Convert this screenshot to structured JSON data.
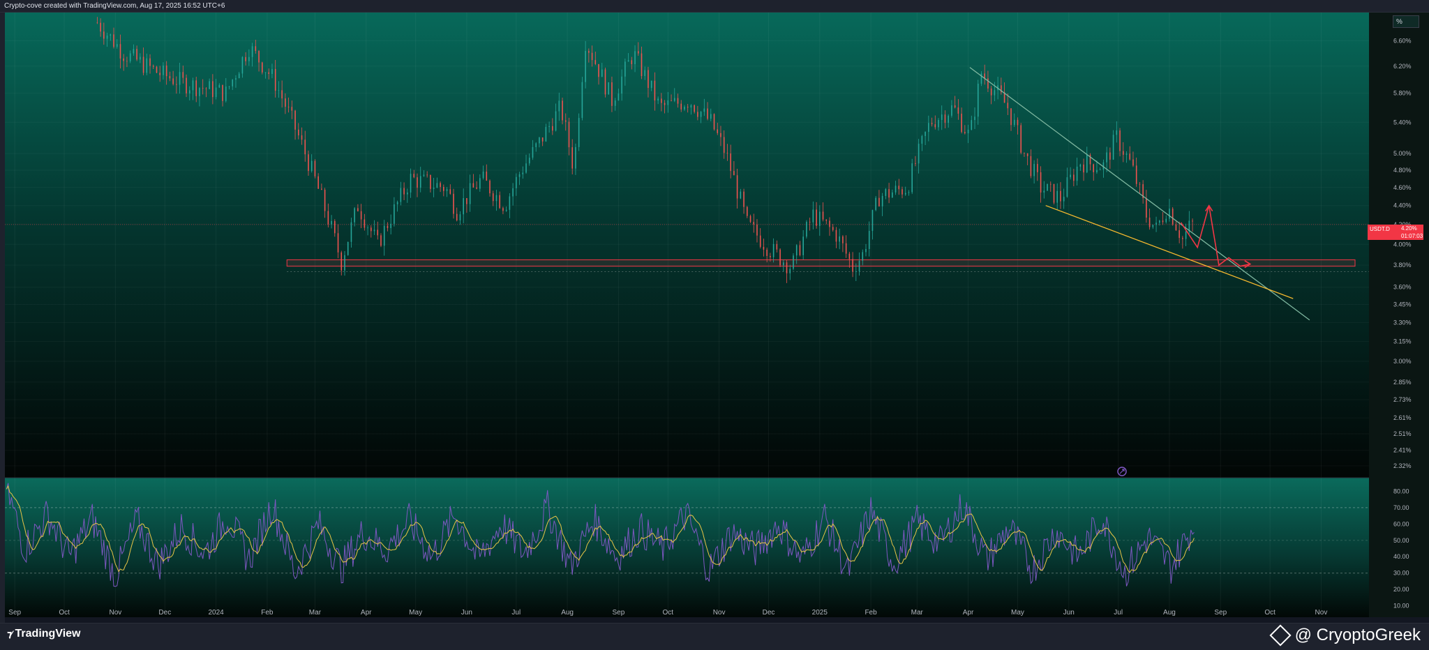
{
  "header": {
    "caption": "Crypto-cove created with TradingView.com, Aug 17, 2025 16:52 UTC+6"
  },
  "scale_button": {
    "label": "%"
  },
  "price_badge": {
    "symbol": "USDT.D",
    "price": "4.20%",
    "countdown": "01:07:03"
  },
  "footer": {
    "brand": "TradingView",
    "watermark": "@ CryoptoGreek"
  },
  "colors": {
    "up_candle": "#26a69a",
    "down_candle": "#ef5350",
    "resistance_line": "#7fb7a0",
    "support_line": "#f5b82e",
    "zone_border": "#f23645",
    "rsi_line": "#7e57c2",
    "rsi_ma": "#e8c547"
  },
  "chart_data": [
    {
      "type": "line",
      "subtype": "candlestick",
      "ylabel": "",
      "y_scale": "log",
      "ylim": [
        2.28,
        7.0
      ],
      "y_ticks": [
        "6.60%",
        "6.20%",
        "5.80%",
        "5.40%",
        "5.00%",
        "4.80%",
        "4.60%",
        "4.40%",
        "4.20%",
        "4.00%",
        "3.80%",
        "3.60%",
        "3.45%",
        "3.30%",
        "3.15%",
        "3.00%",
        "2.85%",
        "2.73%",
        "2.61%",
        "2.51%",
        "2.41%",
        "2.32%"
      ],
      "x_ticks": [
        "Sep",
        "Oct",
        "Nov",
        "Dec",
        "2024",
        "Feb",
        "Mar",
        "Apr",
        "May",
        "Jun",
        "Jul",
        "Aug",
        "Sep",
        "Oct",
        "Nov",
        "Dec",
        "2025",
        "Feb",
        "Mar",
        "Apr",
        "May",
        "Jun",
        "Jul",
        "Aug",
        "Sep",
        "Oct",
        "Nov"
      ],
      "xlim": [
        "2023-08-26",
        "2025-11-30"
      ],
      "series": [
        {
          "x": [
            "2023-10-21",
            "2023-11-06",
            "2023-11-27",
            "2023-12-12",
            "2024-01-07",
            "2024-01-21",
            "2024-02-05",
            "2024-02-26",
            "2024-03-17",
            "2024-03-27",
            "2024-04-08",
            "2024-04-28",
            "2024-05-19",
            "2024-05-26",
            "2024-06-10",
            "2024-06-24",
            "2024-07-04",
            "2024-07-14",
            "2024-07-28",
            "2024-08-05",
            "2024-08-12",
            "2024-08-28",
            "2024-09-10",
            "2024-09-26",
            "2024-10-14",
            "2024-10-27",
            "2024-11-05",
            "2024-11-18",
            "2024-12-02",
            "2024-12-15",
            "2024-12-28",
            "2025-01-11",
            "2025-01-21",
            "2025-01-27",
            "2025-02-06",
            "2025-02-23",
            "2025-03-09",
            "2025-03-23",
            "2025-04-02",
            "2025-04-09",
            "2025-04-25",
            "2025-05-05",
            "2025-05-15",
            "2025-05-27",
            "2025-06-08",
            "2025-06-22",
            "2025-06-30",
            "2025-07-09",
            "2025-07-18",
            "2025-07-24",
            "2025-07-31",
            "2025-08-09",
            "2025-08-14"
          ],
          "y": [
            6.9,
            6.4,
            6.1,
            5.95,
            5.8,
            6.5,
            6.0,
            4.9,
            3.83,
            4.4,
            4.0,
            4.7,
            4.6,
            4.35,
            4.7,
            4.4,
            4.8,
            5.1,
            5.6,
            4.8,
            6.6,
            5.7,
            6.4,
            5.6,
            5.7,
            5.4,
            5.0,
            4.2,
            3.95,
            3.78,
            4.3,
            4.1,
            3.78,
            3.9,
            4.5,
            4.6,
            5.4,
            5.6,
            5.2,
            6.1,
            5.6,
            5.0,
            4.6,
            4.48,
            4.9,
            4.85,
            5.2,
            4.85,
            4.3,
            4.15,
            4.4,
            4.05,
            4.2
          ]
        }
      ],
      "annotations": {
        "support_zone": [
          3.79,
          3.85
        ],
        "resistance_trendline": {
          "x": [
            "2025-04-02",
            "2025-10-25"
          ],
          "y": [
            6.18,
            3.32
          ]
        },
        "support_trendline": {
          "x": [
            "2025-05-18",
            "2025-10-15"
          ],
          "y": [
            4.4,
            3.5
          ]
        },
        "projection": {
          "x": [
            "2025-08-08",
            "2025-08-18",
            "2025-08-25",
            "2025-08-31",
            "2025-09-06",
            "2025-09-13",
            "2025-09-19"
          ],
          "y": [
            4.22,
            3.97,
            4.4,
            3.8,
            3.87,
            3.79,
            3.81
          ]
        }
      },
      "grid": true
    },
    {
      "type": "line",
      "subtype": "oscillator",
      "ylim": [
        6,
        87
      ],
      "y_ticks": [
        "80.00",
        "70.00",
        "60.00",
        "50.00",
        "40.00",
        "30.00",
        "20.00",
        "10.00"
      ],
      "reference_lines": [
        70,
        50,
        30
      ],
      "series": [
        {
          "x": [
            "2023-08-27",
            "2023-09-07",
            "2023-09-21",
            "2023-10-04",
            "2023-10-18",
            "2023-11-01",
            "2023-11-14",
            "2023-11-27",
            "2023-12-11",
            "2023-12-25",
            "2024-01-08",
            "2024-01-21",
            "2024-02-04",
            "2024-02-18",
            "2024-03-03",
            "2024-03-17",
            "2024-03-30",
            "2024-04-13",
            "2024-04-27",
            "2024-05-11",
            "2024-05-25",
            "2024-06-08",
            "2024-06-22",
            "2024-07-06",
            "2024-07-20",
            "2024-08-03",
            "2024-08-17",
            "2024-08-31",
            "2024-09-14",
            "2024-09-28",
            "2024-10-12",
            "2024-10-26",
            "2024-11-09",
            "2024-11-23",
            "2024-12-07",
            "2024-12-21",
            "2025-01-04",
            "2025-01-18",
            "2025-02-01",
            "2025-02-15",
            "2025-03-01",
            "2025-03-15",
            "2025-03-29",
            "2025-04-12",
            "2025-04-26",
            "2025-05-10",
            "2025-05-24",
            "2025-06-07",
            "2025-06-21",
            "2025-07-05",
            "2025-07-19",
            "2025-08-02",
            "2025-08-16"
          ],
          "y": [
            82,
            45,
            66,
            40,
            63,
            28,
            62,
            35,
            58,
            42,
            65,
            38,
            72,
            30,
            60,
            33,
            55,
            44,
            62,
            40,
            66,
            38,
            60,
            42,
            70,
            34,
            63,
            40,
            57,
            45,
            66,
            32,
            55,
            44,
            60,
            38,
            64,
            30,
            68,
            36,
            61,
            48,
            72,
            38,
            58,
            32,
            56,
            40,
            64,
            30,
            52,
            34,
            60
          ]
        }
      ],
      "grid": true
    }
  ]
}
